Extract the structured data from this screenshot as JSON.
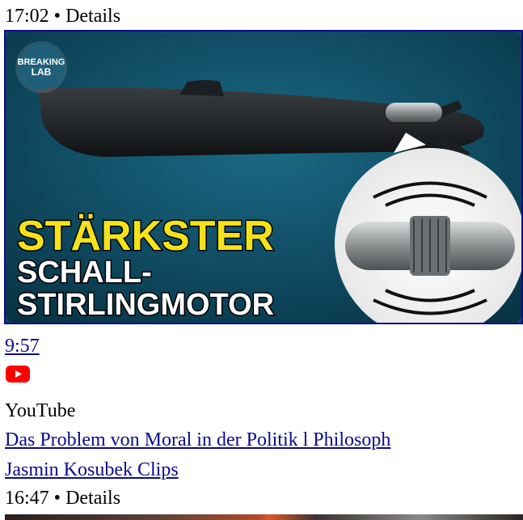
{
  "item1": {
    "meta": "17:02 • Details",
    "thumbnail": {
      "logo_line1": "BREAKING",
      "logo_line2": "LAB",
      "headline1": "STÄRKSTER",
      "headline2": "SCHALL-",
      "headline3": "STIRLINGMOTOR"
    }
  },
  "item2": {
    "duration": "9:57",
    "source": "YouTube",
    "title": "Das Problem von Moral in der Politik l Philosoph",
    "channel": "Jasmin Kosubek Clips",
    "meta": "16:47 • Details"
  },
  "colors": {
    "link": "#0b0b8f",
    "youtube_red": "#ff0000",
    "headline_yellow": "#f4e21a"
  }
}
